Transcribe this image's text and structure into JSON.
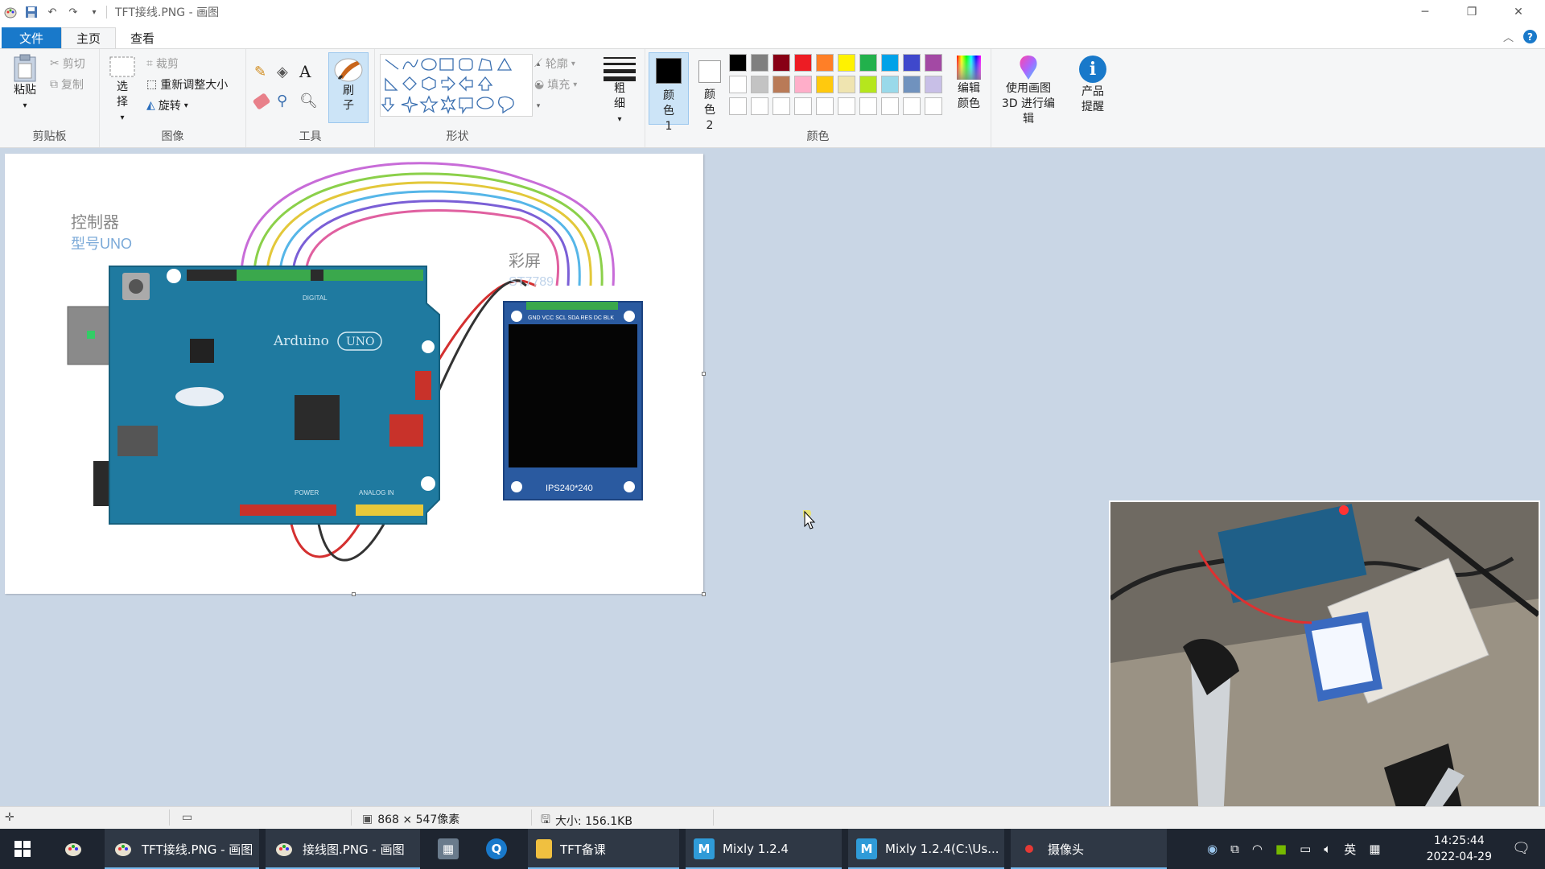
{
  "window": {
    "title": "TFT接线.PNG - 画图"
  },
  "menu": {
    "file": "文件",
    "home": "主页",
    "view": "查看"
  },
  "clipboard": {
    "paste": "粘贴",
    "cut": "剪切",
    "copy": "复制",
    "label": "剪贴板"
  },
  "image": {
    "select": "选择",
    "crop": "裁剪",
    "resize": "重新调整大小",
    "rotate": "旋转",
    "label": "图像"
  },
  "tools": {
    "label": "工具",
    "brushes": "刷子"
  },
  "shapes": {
    "outline": "轮廓",
    "fill": "填充",
    "label": "形状"
  },
  "size": {
    "label": "粗细"
  },
  "colors": {
    "color1": "颜色 1",
    "color2": "颜色 2",
    "edit": "编辑颜色",
    "paint3d": "使用画图 3D 进行编辑",
    "product_alert": "产品提醒",
    "label": "颜色",
    "color1_value": "#000000",
    "color2_value": "#ffffff",
    "palette_row1": [
      "#000000",
      "#7f7f7f",
      "#880015",
      "#ed1c24",
      "#ff7f27",
      "#fff200",
      "#22b14c",
      "#00a2e8",
      "#3f48cc",
      "#a349a4"
    ],
    "palette_row2": [
      "#ffffff",
      "#c3c3c3",
      "#b97a57",
      "#ffaec9",
      "#ffc90e",
      "#efe4b0",
      "#b5e61d",
      "#99d9ea",
      "#7092be",
      "#c8bfe7"
    ]
  },
  "diagram": {
    "controller_title": "控制器",
    "controller_model": "型号UNO",
    "screen_title": "彩屏",
    "screen_model": "ST7789",
    "board_brand": "Arduino",
    "board_model": "UNO",
    "screen_pins": "GND VCC SCL SDA RES DC BLK",
    "screen_size": "IPS240*240",
    "digital_label": "DIGITAL",
    "power_label": "POWER",
    "analog_label": "ANALOG IN"
  },
  "status": {
    "dimensions": "868 × 547像素",
    "filesize": "大小: 156.1KB"
  },
  "taskbar": {
    "items": [
      "TFT接线.PNG - 画图",
      "接线图.PNG - 画图",
      "TFT备课",
      "Mixly 1.2.4",
      "Mixly 1.2.4(C:\\Us...",
      "摄像头"
    ],
    "ime": "英",
    "time": "14:25:44",
    "date": "2022-04-29"
  }
}
